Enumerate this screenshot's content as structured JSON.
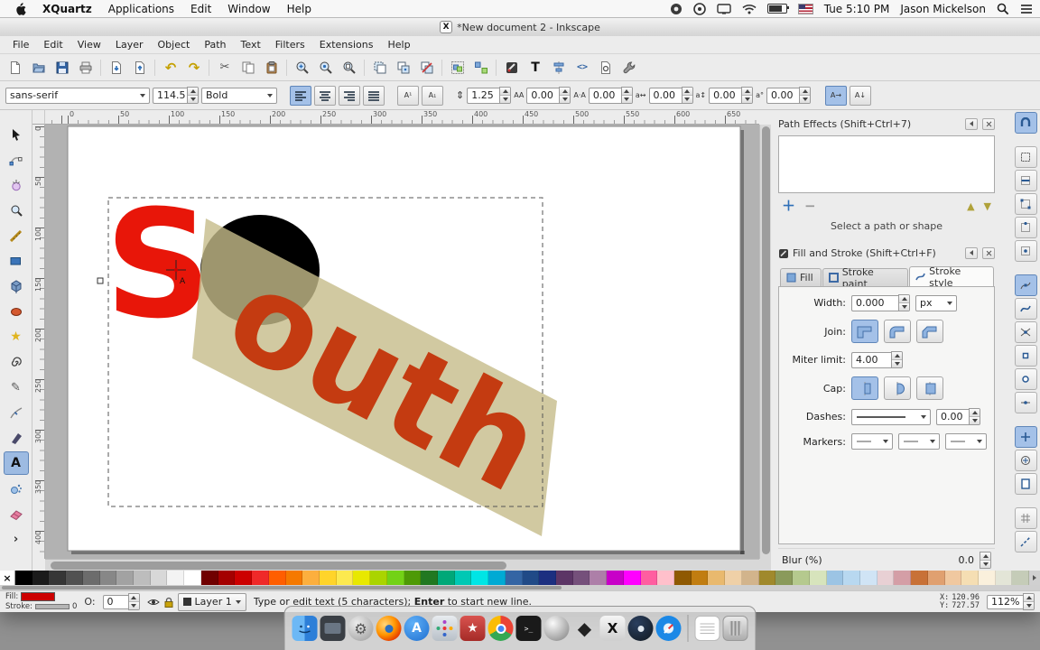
{
  "macos_menubar": {
    "menus": [
      "XQuartz",
      "Applications",
      "Edit",
      "Window",
      "Help"
    ],
    "clock": "Tue 5:10 PM",
    "username": "Jason Mickelson"
  },
  "titlebar": {
    "title": "*New document 2 - Inkscape"
  },
  "inkscape_menus": [
    "File",
    "Edit",
    "View",
    "Layer",
    "Object",
    "Path",
    "Text",
    "Filters",
    "Extensions",
    "Help"
  ],
  "text_toolbar": {
    "font_family": "sans-serif",
    "font_size": "114.5",
    "font_style": "Bold",
    "values": {
      "line_spacing": "1.25",
      "letter_spacing": "0.00",
      "word_spacing": "0.00",
      "horizontal_kerning": "0.00",
      "vertical_shift": "0.00",
      "rotation": "0.00"
    }
  },
  "rulers": {
    "h": [
      "0",
      "50",
      "100",
      "150",
      "200",
      "250",
      "300",
      "350",
      "400",
      "450",
      "500",
      "550",
      "600",
      "650"
    ],
    "v": [
      "0",
      "50",
      "100",
      "150",
      "200",
      "250",
      "300",
      "350",
      "400"
    ]
  },
  "canvas": {
    "s_text": "S",
    "outh_text": "outh",
    "s_color": "#e81609",
    "outh_color": "#c43b11",
    "band_color": "#c5bc89",
    "circle_color": "#000000",
    "page_color": "#ffffff"
  },
  "path_effects": {
    "title": "Path Effects  (Shift+Ctrl+7)",
    "hint": "Select a path or shape"
  },
  "fill_stroke": {
    "title": "Fill and Stroke (Shift+Ctrl+F)",
    "tabs": [
      "Fill",
      "Stroke paint",
      "Stroke style"
    ],
    "labels": {
      "width": "Width:",
      "join": "Join:",
      "miter": "Miter limit:",
      "cap": "Cap:",
      "dashes": "Dashes:",
      "markers": "Markers:",
      "blur": "Blur (%)"
    },
    "values": {
      "width": "0.000",
      "width_unit": "px",
      "miter": "4.00",
      "dash_offset": "0.00",
      "blur": "0.0"
    }
  },
  "statusbar": {
    "fill_label": "Fill:",
    "stroke_label": "Stroke:",
    "fill_color": "#cc0000",
    "stroke_width": "0",
    "opacity_label": "O:",
    "opacity_value": "0",
    "layer_name": "Layer 1",
    "message_pre": "Type or edit text (5 characters); ",
    "message_bold": "Enter",
    "message_post": " to start new line.",
    "x_label": "X:",
    "x_value": "120.96",
    "y_label": "Y:",
    "y_value": "727.57",
    "zoom_value": "112%"
  },
  "icons": {
    "star": "★",
    "gear": "⚙",
    "pencil": "✎",
    "undo": "↶",
    "redo": "↷",
    "cut": "✂",
    "text_tool": "A",
    "text_dialog": "T",
    "xml_editor": "<>",
    "x11": "X",
    "terminal_prompt": ">_",
    "diamond": "◆",
    "chevron_more": "›",
    "superscript": "A¹",
    "subscript": "A₁",
    "line_spacing": "⇕",
    "letter_spacing": "AA",
    "word_spacing": "A·A",
    "horizontal_kerning": "a↔",
    "vertical_shift": "a↕",
    "rotation": "a°",
    "horizontal_text": "A→",
    "vertical_text": "A↓",
    "none_swatch": "×",
    "appstore": "A"
  },
  "palette": {
    "colors": [
      "#000000",
      "#1b1b1b",
      "#363636",
      "#515151",
      "#6c6c6c",
      "#878787",
      "#a2a2a2",
      "#bdbdbd",
      "#d8d8d8",
      "#f3f3f3",
      "#ffffff",
      "#700000",
      "#a40000",
      "#cc0000",
      "#ef2929",
      "#ff5e00",
      "#f57900",
      "#fcaf3e",
      "#ffd42a",
      "#fce94f",
      "#e8e800",
      "#aad400",
      "#73d216",
      "#4e9a06",
      "#217821",
      "#00a878",
      "#00c8b4",
      "#00e5e5",
      "#00aad4",
      "#3465a4",
      "#204a87",
      "#1c2f80",
      "#5c3566",
      "#75507b",
      "#ad7fa8",
      "#c800c8",
      "#ff00ff",
      "#ff5ea0",
      "#ffc0cb",
      "#8f5902",
      "#c17d11",
      "#e9b96e",
      "#efd0a7",
      "#d2b48c",
      "#a0892c",
      "#8a9a5b",
      "#b5c98e",
      "#d7e4bc",
      "#9cc4e4",
      "#b8d8f0",
      "#d0e4f5",
      "#e8d0d4",
      "#d49ea6",
      "#c87137",
      "#e0a070",
      "#f0c8a0",
      "#f5deb3",
      "#faf0dc",
      "#e3e5d7",
      "#c5ccb8"
    ]
  }
}
